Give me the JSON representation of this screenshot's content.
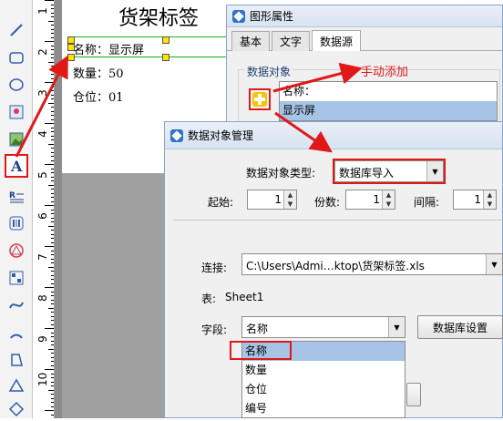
{
  "canvas": {
    "label_title": "货架标签",
    "field_name": "名称：显示屏",
    "field_qty": "数量：50",
    "field_loc": "仓位：01"
  },
  "ruler": {
    "numbers": [
      "1",
      "2",
      "3",
      "4",
      "5",
      "6",
      "7",
      "8",
      "9",
      "10"
    ]
  },
  "prop_window": {
    "title": "图形属性",
    "tabs": [
      "基本",
      "文字",
      "数据源"
    ],
    "active_tab": "数据源",
    "group_label": "数据对象",
    "list_items": [
      "名称：",
      "显示屏"
    ],
    "selected_item": "显示屏"
  },
  "annotation": {
    "text": "手动添加",
    "color": "#e01818"
  },
  "dialog": {
    "title": "数据对象管理",
    "type_label": "数据对象类型:",
    "type_value": "数据库导入",
    "start_label": "起始:",
    "start_value": "1",
    "copies_label": "份数:",
    "copies_value": "1",
    "interval_label": "间隔:",
    "interval_value": "1",
    "conn_label": "连接:",
    "conn_value": "C:\\Users\\Admi…ktop\\货架标签.xls",
    "table_label": "表:",
    "table_value": "Sheet1",
    "field_label": "字段:",
    "field_value": "名称",
    "db_settings_button": "数据库设置",
    "field_options": [
      "名称",
      "数量",
      "仓位",
      "编号"
    ],
    "highlighted_option": "名称"
  },
  "colors": {
    "accent_red": "#e01818",
    "selection_blue": "#a7c4e6",
    "titlebar": "#d8e3f1"
  }
}
